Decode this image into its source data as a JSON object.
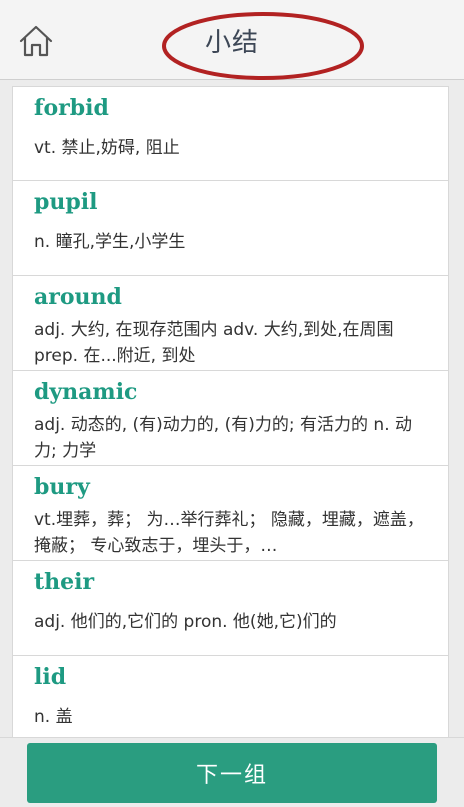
{
  "header": {
    "title": "小结",
    "home_icon": "home-icon",
    "annotation_color": "#b22222"
  },
  "words": [
    {
      "word": "forbid",
      "definition": "vt. 禁止,妨碍, 阻止"
    },
    {
      "word": "pupil",
      "definition": "n. 瞳孔,学生,小学生"
    },
    {
      "word": "around",
      "definition": "adj. 大约, 在现存范围内 adv. 大约,到处,在周围 prep. 在...附近, 到处"
    },
    {
      "word": "dynamic",
      "definition": "adj. 动态的, (有)动力的, (有)力的; 有活力的 n. 动力; 力学"
    },
    {
      "word": "bury",
      "definition": "vt.埋葬，葬； 为…举行葬礼； 隐藏，埋藏，遮盖，掩蔽； 专心致志于，埋头于，…"
    },
    {
      "word": "their",
      "definition": "adj. 他们的,它们的 pron. 他(她,它)们的"
    },
    {
      "word": "lid",
      "definition": "n. 盖"
    }
  ],
  "footer": {
    "next_label": "下一组"
  },
  "colors": {
    "accent": "#2a9d80",
    "word": "#1e9a82"
  }
}
